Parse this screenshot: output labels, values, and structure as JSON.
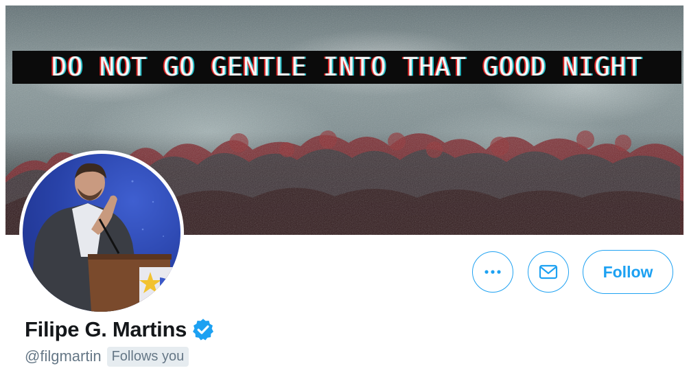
{
  "banner": {
    "text": "DO NOT GO GENTLE INTO THAT GOOD NIGHT"
  },
  "profile": {
    "name": "Filipe G. Martins",
    "handle": "@filgmartin",
    "follows_you": "Follows you",
    "verified": true
  },
  "actions": {
    "more_icon": "more-horizontal-icon",
    "message_icon": "envelope-icon",
    "follow_label": "Follow"
  },
  "colors": {
    "accent": "#1da1f2",
    "text_primary": "#14171a",
    "text_secondary": "#657786",
    "badge_bg": "#e6ecf0"
  }
}
